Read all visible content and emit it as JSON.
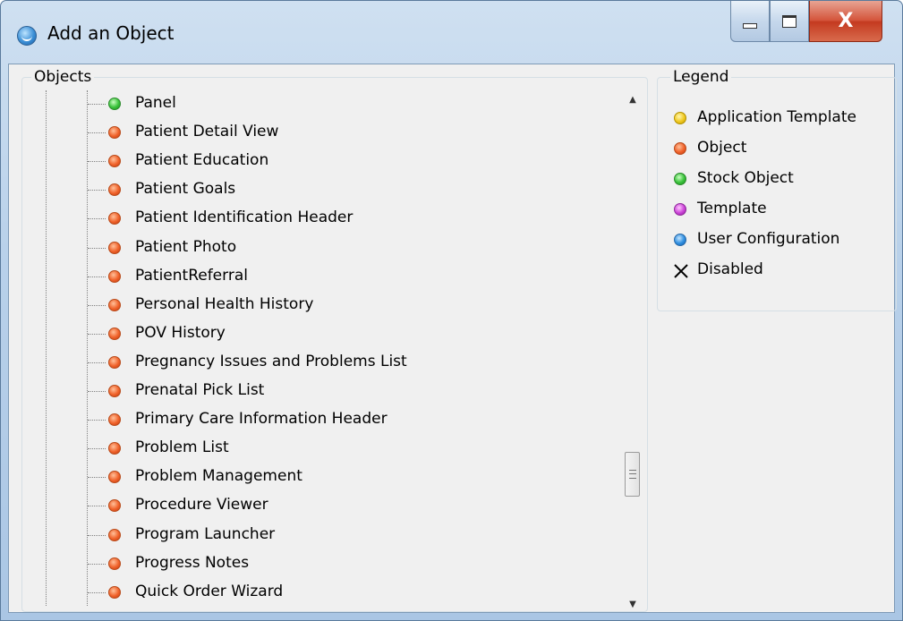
{
  "window": {
    "title": "Add an Object",
    "minimize_label": "",
    "close_label": "X"
  },
  "objects": {
    "label": "Objects",
    "items": [
      {
        "label": "Panel",
        "kind": "stock"
      },
      {
        "label": "Patient Detail View",
        "kind": "object"
      },
      {
        "label": "Patient Education",
        "kind": "object"
      },
      {
        "label": "Patient Goals",
        "kind": "object"
      },
      {
        "label": "Patient Identification Header",
        "kind": "object"
      },
      {
        "label": "Patient Photo",
        "kind": "object"
      },
      {
        "label": "PatientReferral",
        "kind": "object"
      },
      {
        "label": "Personal Health History",
        "kind": "object"
      },
      {
        "label": "POV History",
        "kind": "object"
      },
      {
        "label": "Pregnancy Issues and Problems List",
        "kind": "object"
      },
      {
        "label": "Prenatal Pick List",
        "kind": "object"
      },
      {
        "label": "Primary Care Information Header",
        "kind": "object"
      },
      {
        "label": "Problem List",
        "kind": "object"
      },
      {
        "label": "Problem Management",
        "kind": "object"
      },
      {
        "label": "Procedure Viewer",
        "kind": "object"
      },
      {
        "label": "Program Launcher",
        "kind": "object"
      },
      {
        "label": "Progress Notes",
        "kind": "object"
      },
      {
        "label": "Quick Order Wizard",
        "kind": "object"
      }
    ],
    "scroll_fraction": 0.72
  },
  "legend": {
    "label": "Legend",
    "items": [
      {
        "label": "Application Template",
        "icon": "yellow-dot-icon",
        "color": "#f0c820"
      },
      {
        "label": "Object",
        "icon": "orange-dot-icon",
        "color": "#f0622a"
      },
      {
        "label": "Stock Object",
        "icon": "green-dot-icon",
        "color": "#39c23a"
      },
      {
        "label": "Template",
        "icon": "magenta-dot-icon",
        "color": "#cc44d8"
      },
      {
        "label": "User Configuration",
        "icon": "blue-dot-icon",
        "color": "#2e8ee0"
      },
      {
        "label": "Disabled",
        "icon": "x-icon",
        "color": "#000000"
      }
    ]
  }
}
